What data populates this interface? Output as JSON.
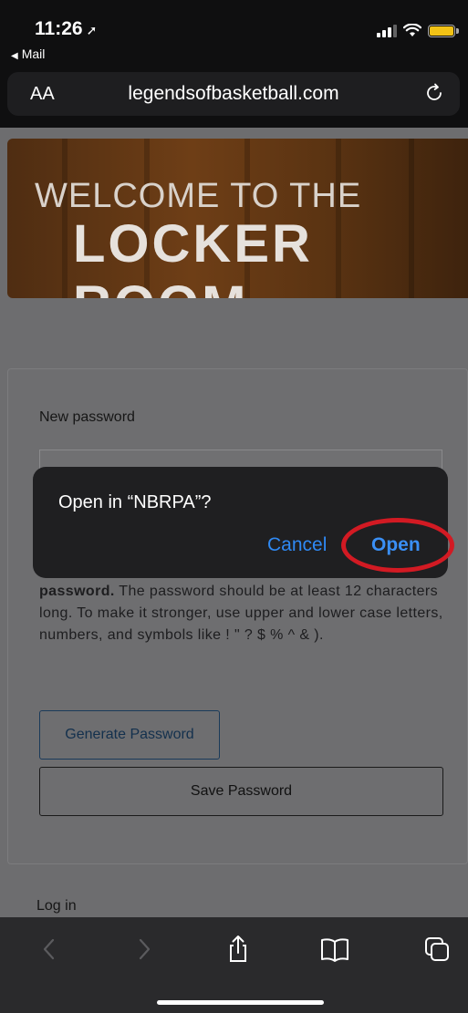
{
  "status": {
    "time": "11:26",
    "back_app": "Mail"
  },
  "browser": {
    "aa_label": "AA",
    "url": "legendsofbasketball.com"
  },
  "banner": {
    "line1": "WELCOME TO THE",
    "line2": "LOCKER ROOM"
  },
  "form": {
    "new_password_label": "New password",
    "hint_bold": "password.",
    "hint_text": " The password should be at least 12 characters long. To make it stronger, use upper and lower case letters, numbers, and symbols like ! \" ? $ % ^ & ).",
    "generate_label": "Generate Password",
    "save_label": "Save Password"
  },
  "footer": {
    "login_label": "Log in"
  },
  "dialog": {
    "title": "Open in “NBRPA”?",
    "cancel_label": "Cancel",
    "open_label": "Open"
  },
  "colors": {
    "dialog_blue": "#2f89f3",
    "annotation_red": "#d21a23",
    "battery_yellow": "#f3c316"
  },
  "icons": [
    "location-arrow-icon",
    "signal-icon",
    "wifi-icon",
    "battery-icon",
    "reload-icon",
    "back-chevron-icon",
    "forward-chevron-icon",
    "share-icon",
    "bookmarks-icon",
    "tabs-icon"
  ]
}
